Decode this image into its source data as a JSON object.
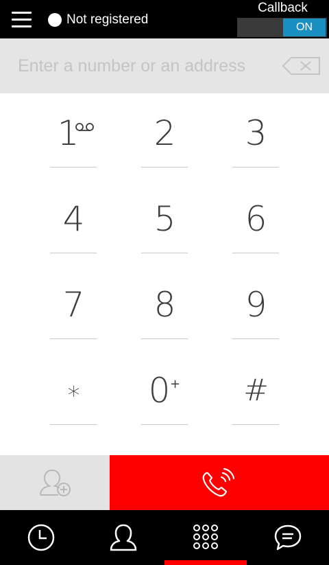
{
  "topbar": {
    "menu_icon": "hamburger-icon",
    "status_text": "Not registered",
    "callback_label": "Callback",
    "callback_state": "ON"
  },
  "input": {
    "placeholder": "Enter a number or an address",
    "value": "",
    "backspace_icon": "backspace-icon"
  },
  "keypad": {
    "keys": [
      {
        "digit": "1",
        "sub": "voicemail-icon"
      },
      {
        "digit": "2"
      },
      {
        "digit": "3"
      },
      {
        "digit": "4"
      },
      {
        "digit": "5"
      },
      {
        "digit": "6"
      },
      {
        "digit": "7"
      },
      {
        "digit": "8"
      },
      {
        "digit": "9"
      },
      {
        "digit": "*"
      },
      {
        "digit": "0",
        "sub": "+"
      },
      {
        "digit": "#"
      }
    ]
  },
  "actions": {
    "add_contact_icon": "add-contact-icon",
    "call_icon": "phone-call-icon"
  },
  "bottom_nav": {
    "items": [
      "history-icon",
      "contacts-icon",
      "dialpad-icon",
      "chat-icon"
    ],
    "active_index": 2
  },
  "colors": {
    "accent_red": "#ff0000",
    "toggle_blue": "#1a8fc2",
    "input_bg": "#e5e5e5",
    "topbar_bg": "#000000"
  }
}
